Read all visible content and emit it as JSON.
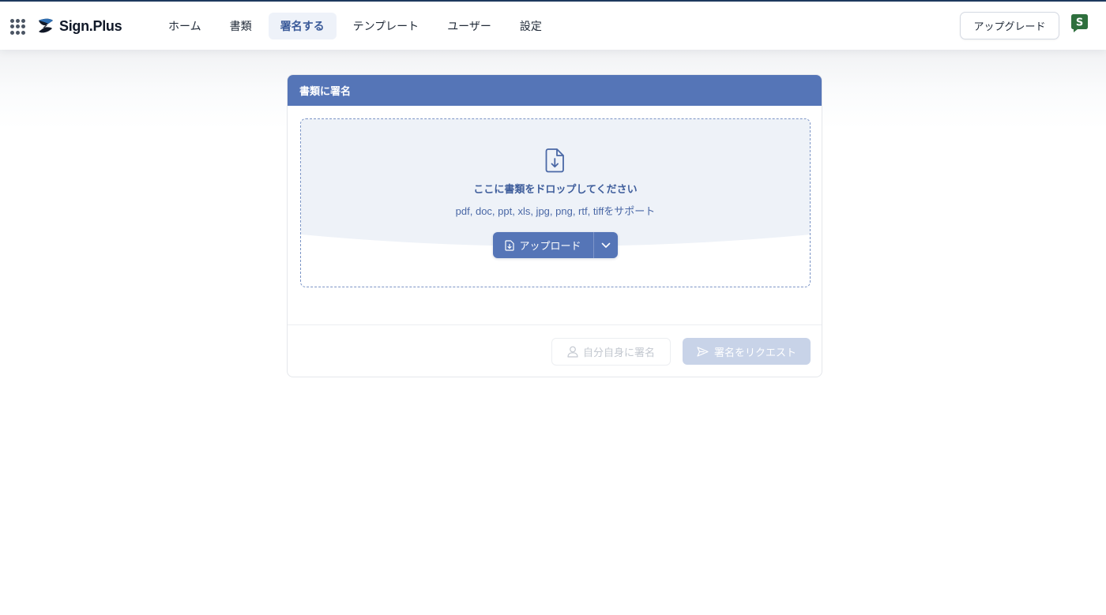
{
  "app": {
    "brand": "Sign.Plus",
    "avatar_letter": "S",
    "colors": {
      "accent": "#5575b7",
      "navy": "#1e3a5f",
      "logo_green": "#2e6f3d"
    }
  },
  "nav": {
    "items": [
      {
        "label": "ホーム",
        "active": false
      },
      {
        "label": "書類",
        "active": false
      },
      {
        "label": "署名する",
        "active": true
      },
      {
        "label": "テンプレート",
        "active": false
      },
      {
        "label": "ユーザー",
        "active": false
      },
      {
        "label": "設定",
        "active": false
      }
    ],
    "upgrade_label": "アップグレード"
  },
  "sign_card": {
    "title": "書類に署名",
    "dropzone": {
      "title": "ここに書類をドロップしてください",
      "formats": "pdf, doc, ppt, xls, jpg, png, rtf, tiffをサポート",
      "upload_label": "アップロード"
    },
    "actions": {
      "self_sign_label": "自分自身に署名",
      "request_label": "署名をリクエスト"
    }
  },
  "icons": {
    "apps": "apps-grid-icon",
    "logo": "signplus-logo-icon",
    "avatar": "user-avatar-icon",
    "file": "file-download-icon",
    "upload": "file-upload-icon",
    "caret": "chevron-down-icon",
    "user": "user-icon",
    "send": "send-icon"
  }
}
